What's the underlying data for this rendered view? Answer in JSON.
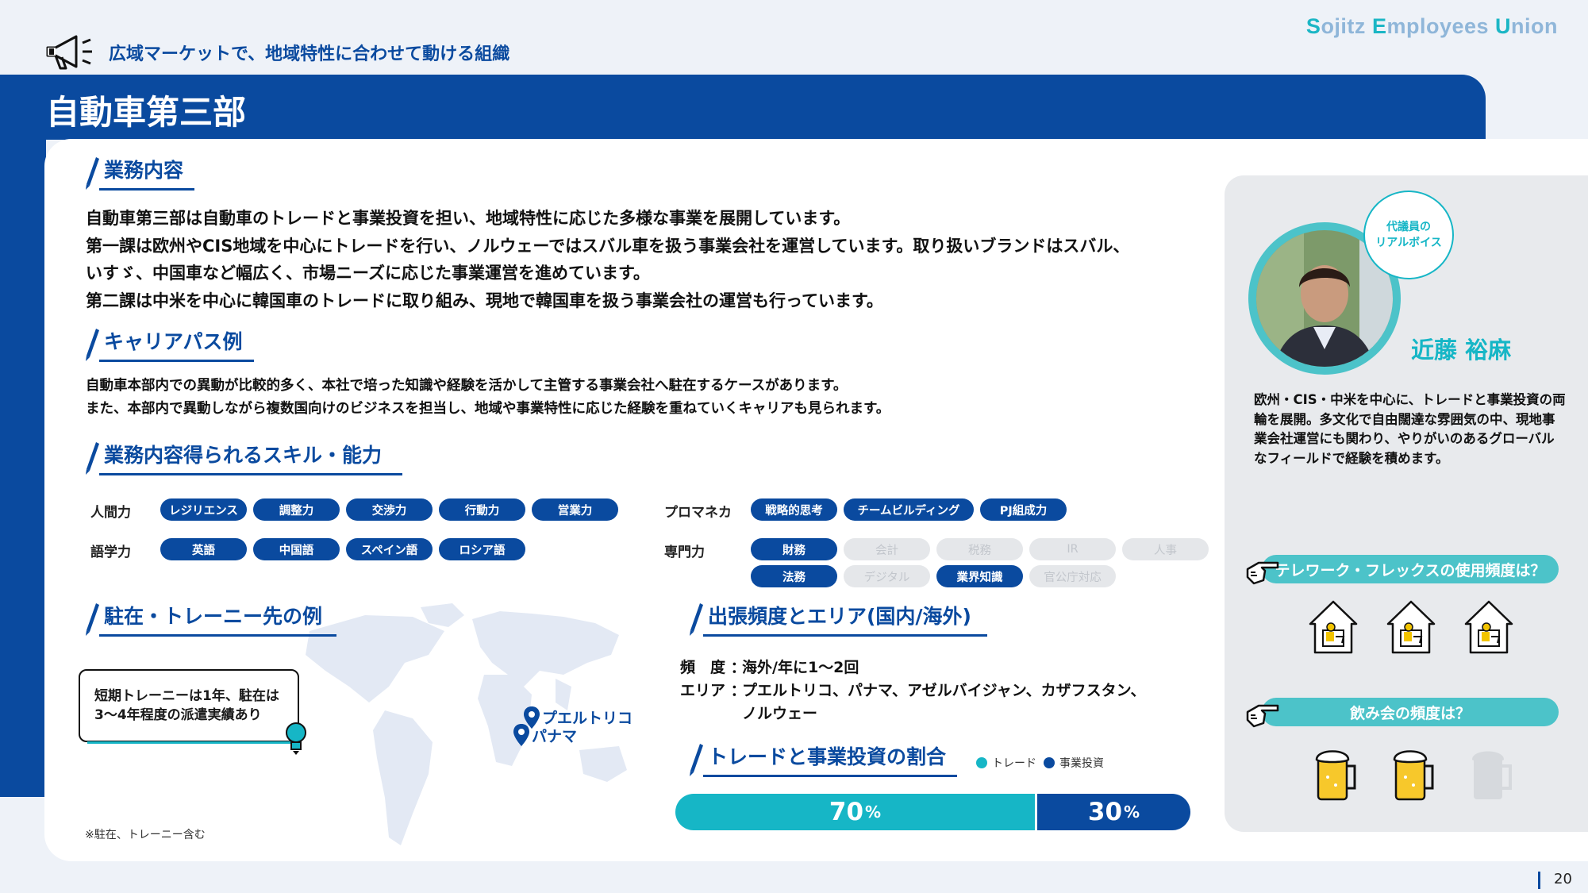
{
  "header": {
    "brand_parts": [
      "S",
      "ojitz ",
      "E",
      "mployees ",
      "U",
      "nion"
    ],
    "tagline": "広域マーケットで、地域特性に合わせて動ける組織",
    "department": "自動車第三部",
    "page_number": "20"
  },
  "business": {
    "title": "業務内容",
    "lines": [
      "自動車第三部は自動車のトレードと事業投資を担い、地域特性に応じた多様な事業を展開しています。",
      "第一課は欧州やCIS地域を中心にトレードを行い、ノルウェーではスバル車を扱う事業会社を運営しています。取り扱いブランドはスバル、",
      "いすゞ、中国車など幅広く、市場ニーズに応じた事業運営を進めています。",
      "第二課は中米を中心に韓国車のトレードに取り組み、現地で韓国車を扱う事業会社の運営も行っています。"
    ]
  },
  "career": {
    "title": "キャリアパス例",
    "lines": [
      "自動車本部内での異動が比較的多く、本社で培った知識や経験を活かして主管する事業会社へ駐在するケースがあります。",
      "また、本部内で異動しながら複数国向けのビジネスを担当し、地域や事業特性に応じた経験を重ねていくキャリアも見られます。"
    ]
  },
  "skills": {
    "title": "業務内容得られるスキル・能力",
    "human": {
      "label": "人間力",
      "items": [
        "レジリエンス",
        "調整力",
        "交渉力",
        "行動力",
        "営業力"
      ]
    },
    "language": {
      "label": "語学力",
      "items": [
        "英語",
        "中国語",
        "スペイン語",
        "ロシア語"
      ]
    },
    "promanager": {
      "label": "プロマネカ",
      "items": [
        "戦略的思考",
        "チームビルディング",
        "PJ組成力"
      ]
    },
    "expertise": {
      "label": "専門力",
      "row1": [
        {
          "t": "財務",
          "on": true
        },
        {
          "t": "会計",
          "on": false
        },
        {
          "t": "税務",
          "on": false
        },
        {
          "t": "IR",
          "on": false
        },
        {
          "t": "人事",
          "on": false
        }
      ],
      "row2": [
        {
          "t": "法務",
          "on": true
        },
        {
          "t": "デジタル",
          "on": false
        },
        {
          "t": "業界知識",
          "on": true
        },
        {
          "t": "官公庁対応",
          "on": false
        }
      ]
    }
  },
  "assignment": {
    "title": "駐在・トレーニー先の例",
    "callout_lines": [
      "短期トレーニーは1年、駐在は",
      "3～4年程度の派遣実績あり"
    ],
    "pins": [
      "プエルトリコ",
      "パナマ"
    ],
    "note": "※駐在、トレーニー含む"
  },
  "travel": {
    "title": "出張頻度とエリア(国内/海外)",
    "freq_label": "頻　度 ：",
    "freq_value": "海外/年に1～2回",
    "area_label": "エリア ：",
    "area_value_1": "プエルトリコ、パナマ、アゼルバイジャン、カザフスタン、",
    "area_value_2": "ノルウェー"
  },
  "ratio": {
    "title": "トレードと事業投資の割合",
    "legend_trade": "トレード",
    "legend_invest": "事業投資",
    "trade_value": "70",
    "invest_value": "30",
    "unit": "%",
    "colors": {
      "trade": "#16b6c6",
      "invest": "#0a4a9f"
    }
  },
  "representative": {
    "bubble_lines": [
      "代議員の",
      "リアルボイス"
    ],
    "name": "近藤 裕麻",
    "text": "欧州・CIS・中米を中心に、トレードと事業投資の両輪を展開。多文化で自由闊達な雰囲気の中、現地事業会社運営にも関わり、やりがいのあるグローバルなフィールドで経験を積めます。",
    "q1": "テレワーク・フレックスの使用頻度は？",
    "q1_level": 3,
    "q2": "飲み会の頻度は？",
    "q2_level": 2
  }
}
